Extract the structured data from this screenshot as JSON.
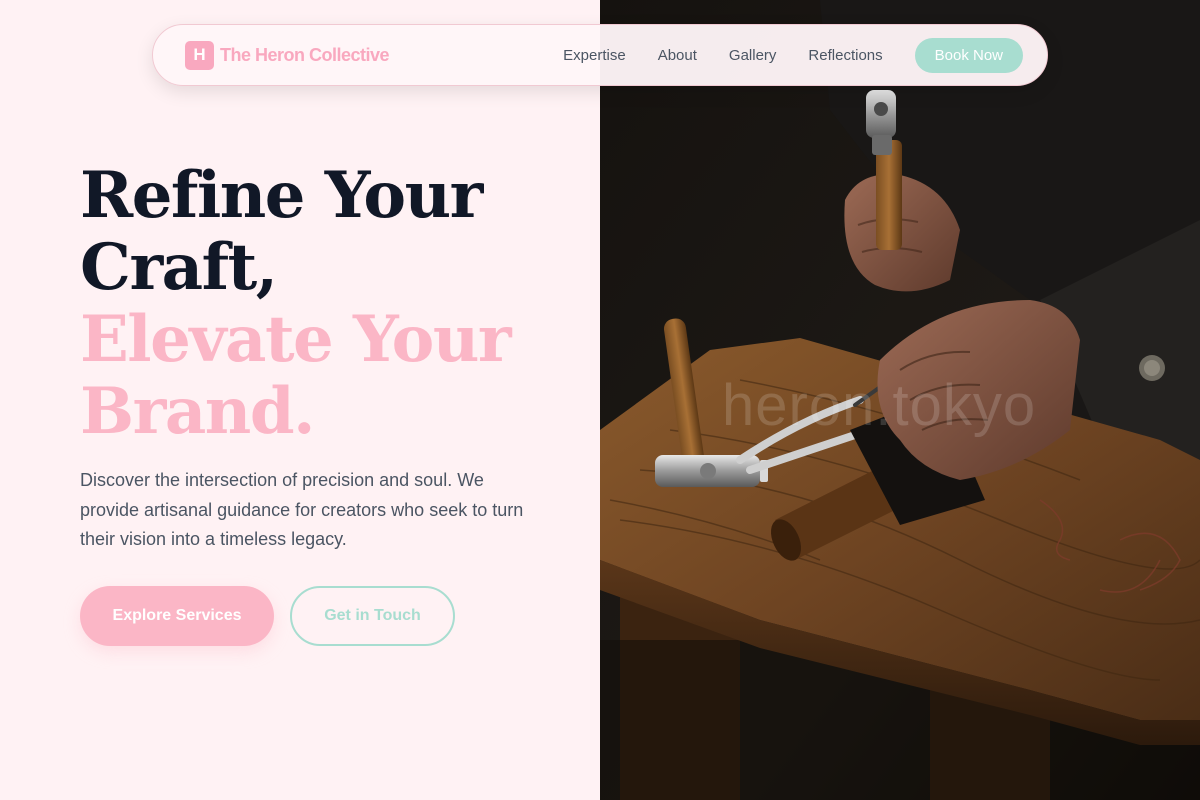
{
  "brand": {
    "mark": "H",
    "name": "The Heron Collective"
  },
  "nav": {
    "links": [
      "Expertise",
      "About",
      "Gallery",
      "Reflections"
    ],
    "cta": "Book Now"
  },
  "hero": {
    "title_line1": "Refine Your Craft,",
    "title_line2": "Elevate Your Brand.",
    "description": "Discover the intersection of precision and soul. We provide artisanal guidance for creators who seek to turn their vision into a timeless legacy.",
    "primary_button": "Explore Services",
    "secondary_button": "Get in Touch"
  },
  "photo": {
    "watermark": "heron.tokyo",
    "subject": "craftsman-hands-tools-workbench"
  },
  "colors": {
    "background": "#fff2f4",
    "accent_pink": "#fbb6c6",
    "accent_mint": "#a8ddd0",
    "heading_dark": "#111827",
    "body_text": "#4b5563"
  }
}
